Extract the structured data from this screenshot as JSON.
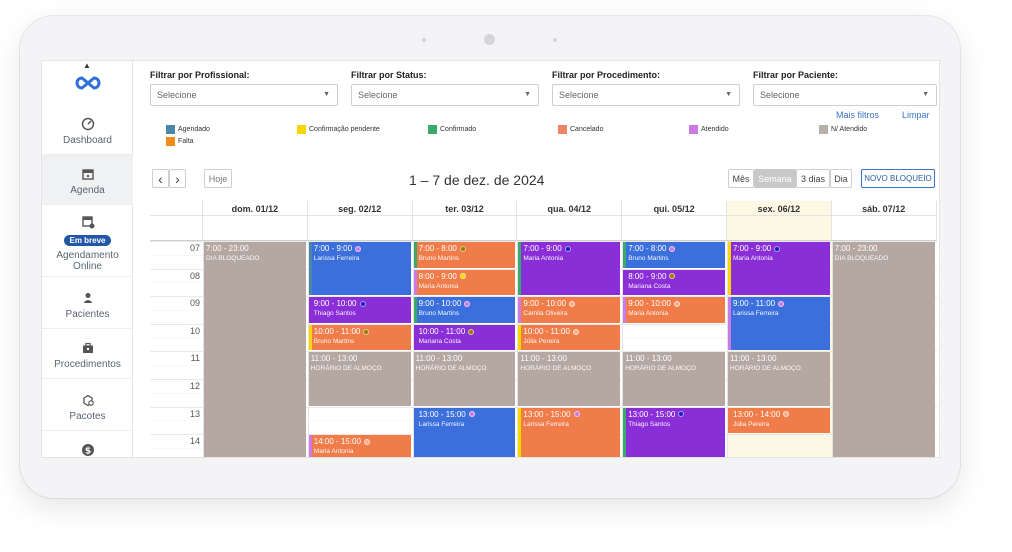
{
  "sidebar": {
    "items": [
      {
        "label": "Dashboard",
        "icon": "gauge-icon"
      },
      {
        "label": "Agenda",
        "icon": "calendar-icon"
      },
      {
        "label": "Agendamento Online",
        "badge": "Em breve",
        "icon": "online-calendar-icon"
      },
      {
        "label": "Pacientes",
        "icon": "person-icon"
      },
      {
        "label": "Procedimentos",
        "icon": "briefcase-icon"
      },
      {
        "label": "Pacotes",
        "icon": "package-icon"
      },
      {
        "label": "",
        "icon": "dollar-icon"
      }
    ]
  },
  "filters": [
    {
      "label": "Filtrar por Profissional:",
      "placeholder": "Selecione"
    },
    {
      "label": "Filtrar por Status:",
      "placeholder": "Selecione"
    },
    {
      "label": "Filtrar por Procedimento:",
      "placeholder": "Selecione"
    },
    {
      "label": "Filtrar por Paciente:",
      "placeholder": "Selecione"
    }
  ],
  "links": {
    "more_filters": "Mais filtros",
    "clear": "Limpar"
  },
  "legend": [
    {
      "label": "Agendado",
      "color": "#4a86a8"
    },
    {
      "label": "Falta",
      "color": "#f08c18"
    },
    {
      "label": "Confirmação pendente",
      "color": "#f5d800"
    },
    {
      "label": "Confirmado",
      "color": "#3aaa6a"
    },
    {
      "label": "Cancelado",
      "color": "#ee8466"
    },
    {
      "label": "Atendido",
      "color": "#cc7ae6"
    },
    {
      "label": "N/ Atendido",
      "color": "#b5b0a8"
    }
  ],
  "toolbar": {
    "prev": "‹",
    "next": "›",
    "today": "Hoje",
    "title": "1 – 7 de dez. de 2024",
    "views": [
      "Mês",
      "Semana",
      "3 dias",
      "Dia"
    ],
    "active_view": "Semana",
    "new_block": "NOVO BLOQUEIO"
  },
  "calendar": {
    "days": [
      "dom. 01/12",
      "seg. 02/12",
      "ter. 03/12",
      "qua. 04/12",
      "qui. 05/12",
      "sex. 06/12",
      "sáb. 07/12"
    ],
    "hours": [
      "07",
      "08",
      "09",
      "10",
      "11",
      "12",
      "13",
      "14"
    ],
    "events": [
      {
        "day": 0,
        "start": 7,
        "end": 23,
        "time": "7:00 - 23:00",
        "name": "DIA BLOQUEADO",
        "color": "#b5a7a2",
        "strip": "",
        "dot": ""
      },
      {
        "day": 6,
        "start": 7,
        "end": 23,
        "time": "7:00 - 23:00",
        "name": "DIA BLOQUEADO",
        "color": "#b5a7a2",
        "strip": "",
        "dot": ""
      },
      {
        "day": 1,
        "start": 7,
        "end": 9,
        "time": "7:00 - 9:00",
        "name": "Larissa Ferreira",
        "color": "#3a6fdc",
        "strip": "#4a86a8",
        "dot": "#cc7ae6"
      },
      {
        "day": 1,
        "start": 9,
        "end": 10,
        "time": "9:00 - 10:00",
        "name": "Thiago Santos",
        "color": "#8a2fd8",
        "strip": "#8a2fd8",
        "dot": "#1a1acc"
      },
      {
        "day": 1,
        "start": 10,
        "end": 11,
        "time": "10:00 - 11:00",
        "name": "Bruno Martins",
        "color": "#f07c4a",
        "strip": "#f5d800",
        "dot": "#a07800"
      },
      {
        "day": 1,
        "start": 11,
        "end": 13,
        "time": "11:00 - 13:00",
        "name": "HORÁRIO DE ALMOÇO",
        "color": "#b5a7a2",
        "strip": "",
        "dot": ""
      },
      {
        "day": 1,
        "start": 14,
        "end": 15,
        "time": "14:00 - 15:00",
        "name": "Maria Antonia",
        "color": "#f07c4a",
        "strip": "#cc7ae6",
        "dot": "#f5b090"
      },
      {
        "day": 2,
        "start": 7,
        "end": 8,
        "time": "7:00 - 8:00",
        "name": "Bruno Martins",
        "color": "#f07c4a",
        "strip": "#3aaa6a",
        "dot": "#a07800"
      },
      {
        "day": 2,
        "start": 8,
        "end": 9,
        "time": "8:00 - 9:00",
        "name": "Maria Antonia",
        "color": "#f07c4a",
        "strip": "#cc7ae6",
        "dot": "#f5d800"
      },
      {
        "day": 2,
        "start": 9,
        "end": 10,
        "time": "9:00 - 10:00",
        "name": "Bruno Martins",
        "color": "#3a6fdc",
        "strip": "#3aaa6a",
        "dot": "#cc7ae6"
      },
      {
        "day": 2,
        "start": 10,
        "end": 11,
        "time": "10:00 - 11:00",
        "name": "Mariana Costa",
        "color": "#8a2fd8",
        "strip": "#8a2fd8",
        "dot": "#a07800"
      },
      {
        "day": 2,
        "start": 11,
        "end": 13,
        "time": "11:00 - 13:00",
        "name": "HORÁRIO DE ALMOÇO",
        "color": "#b5a7a2",
        "strip": "",
        "dot": ""
      },
      {
        "day": 2,
        "start": 13,
        "end": 16,
        "time": "13:00 - 15:00",
        "name": "Larissa Ferreira",
        "color": "#3a6fdc",
        "strip": "#3a6fdc",
        "dot": "#cc7ae6"
      },
      {
        "day": 3,
        "start": 7,
        "end": 9,
        "time": "7:00 - 9:00",
        "name": "Maria Antonia",
        "color": "#8a2fd8",
        "strip": "#3aaa6a",
        "dot": "#1a1acc"
      },
      {
        "day": 3,
        "start": 9,
        "end": 10,
        "time": "9:00 - 10:00",
        "name": "Camila Oliveira",
        "color": "#f07c4a",
        "strip": "#cc7ae6",
        "dot": "#f5b090"
      },
      {
        "day": 3,
        "start": 10,
        "end": 11,
        "time": "10:00 - 11:00",
        "name": "Júlia Pereira",
        "color": "#f07c4a",
        "strip": "#f5d800",
        "dot": "#f5b090"
      },
      {
        "day": 3,
        "start": 11,
        "end": 13,
        "time": "11:00 - 13:00",
        "name": "HORÁRIO DE ALMOÇO",
        "color": "#b5a7a2",
        "strip": "",
        "dot": ""
      },
      {
        "day": 3,
        "start": 13,
        "end": 16,
        "time": "13:00 - 15:00",
        "name": "Larissa Ferreira",
        "color": "#f07c4a",
        "strip": "#f5d800",
        "dot": "#cc7ae6"
      },
      {
        "day": 4,
        "start": 7,
        "end": 8,
        "time": "7:00 - 8:00",
        "name": "Bruno Martins",
        "color": "#3a6fdc",
        "strip": "#3aaa6a",
        "dot": "#cc7ae6"
      },
      {
        "day": 4,
        "start": 8,
        "end": 9,
        "time": "8:00 - 9:00",
        "name": "Mariana Costa",
        "color": "#8a2fd8",
        "strip": "#8a2fd8",
        "dot": "#a07800"
      },
      {
        "day": 4,
        "start": 9,
        "end": 10,
        "time": "9:00 - 10:00",
        "name": "Maria Antonia",
        "color": "#f07c4a",
        "strip": "#cc7ae6",
        "dot": "#f5b090"
      },
      {
        "day": 4,
        "start": 11,
        "end": 13,
        "time": "11:00 - 13:00",
        "name": "HORÁRIO DE ALMOÇO",
        "color": "#b5a7a2",
        "strip": "",
        "dot": ""
      },
      {
        "day": 4,
        "start": 13,
        "end": 16,
        "time": "13:00 - 15:00",
        "name": "Thiago Santos",
        "color": "#8a2fd8",
        "strip": "#3aaa6a",
        "dot": "#1a1acc"
      },
      {
        "day": 5,
        "start": 7,
        "end": 9,
        "time": "7:00 - 9:00",
        "name": "Maria Antonia",
        "color": "#8a2fd8",
        "strip": "#f5d800",
        "dot": "#1a1acc"
      },
      {
        "day": 5,
        "start": 9,
        "end": 11,
        "time": "9:00 - 11:00",
        "name": "Larissa Ferreira",
        "color": "#3a6fdc",
        "strip": "#cc7ae6",
        "dot": "#cc7ae6"
      },
      {
        "day": 5,
        "start": 11,
        "end": 13,
        "time": "11:00 - 13:00",
        "name": "HORÁRIO DE ALMOÇO",
        "color": "#b5a7a2",
        "strip": "",
        "dot": ""
      },
      {
        "day": 5,
        "start": 13,
        "end": 14,
        "time": "13:00 - 14:00",
        "name": "Júlia Pereira",
        "color": "#f07c4a",
        "strip": "#f07c4a",
        "dot": "#f5b090"
      }
    ]
  }
}
